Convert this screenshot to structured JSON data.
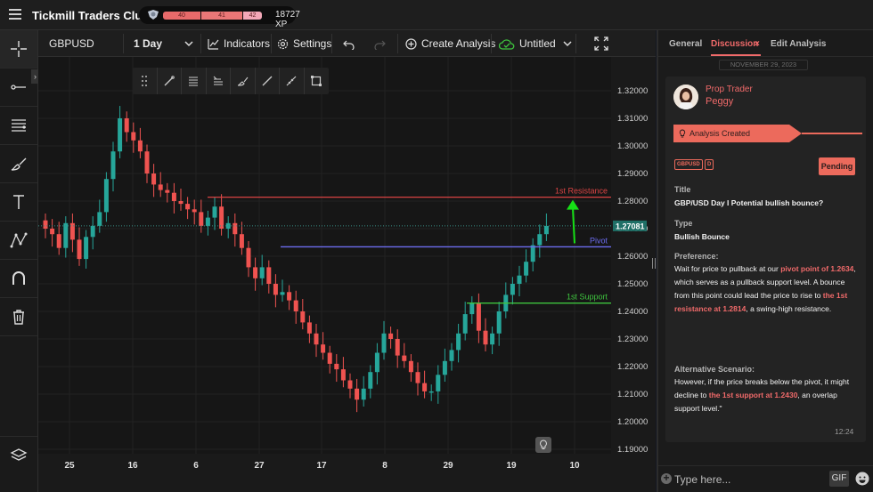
{
  "app": {
    "title": "Tickmill Traders Club"
  },
  "xp": {
    "level_1": "40",
    "level_2": "41",
    "level_3": "42",
    "total": "18727 XP"
  },
  "toolbar": {
    "symbol": "GBPUSD",
    "interval": "1 Day",
    "indicators_label": "Indicators",
    "settings_label": "Settings",
    "create_analysis_label": "Create Analysis",
    "layout_name": "Untitled"
  },
  "chart": {
    "last_price": "1.27081",
    "price_labels": [
      "1.32000",
      "1.31000",
      "1.30000",
      "1.29000",
      "1.28000",
      "1.27000",
      "1.26000",
      "1.25000",
      "1.24000",
      "1.23000",
      "1.22000",
      "1.21000",
      "1.20000",
      "1.19000"
    ],
    "date_labels": [
      "25",
      "16",
      "6",
      "27",
      "17",
      "8",
      "29",
      "19",
      "10"
    ],
    "resistance_label": "1st Resistance",
    "pivot_label": "Pivot",
    "support_label": "1st Support",
    "colors": {
      "up": "#26a69a",
      "down": "#ef5350",
      "resistance": "#d84343",
      "pivot": "#6c6cf0",
      "support": "#3ec43e",
      "arrow": "#16e016"
    }
  },
  "chart_data": {
    "type": "candlestick",
    "series": [
      {
        "name": "GBPUSD",
        "close": [
          1.27,
          1.268,
          1.263,
          1.272,
          1.266,
          1.259,
          1.267,
          1.271,
          1.276,
          1.288,
          1.298,
          1.31,
          1.305,
          1.302,
          1.298,
          1.29,
          1.286,
          1.284,
          1.283,
          1.28,
          1.279,
          1.277,
          1.276,
          1.271,
          1.274,
          1.278,
          1.27,
          1.272,
          1.268,
          1.263,
          1.256,
          1.252,
          1.256,
          1.25,
          1.246,
          1.247,
          1.244,
          1.24,
          1.236,
          1.232,
          1.228,
          1.225,
          1.221,
          1.219,
          1.215,
          1.212,
          1.208,
          1.212,
          1.218,
          1.225,
          1.232,
          1.23,
          1.224,
          1.222,
          1.218,
          1.214,
          1.211,
          1.211,
          1.217,
          1.222,
          1.226,
          1.232,
          1.239,
          1.243,
          1.233,
          1.228,
          1.232,
          1.24,
          1.246,
          1.25,
          1.253,
          1.258,
          1.264,
          1.268,
          1.271
        ]
      }
    ],
    "levels": {
      "resistance": 1.2814,
      "pivot": 1.2634,
      "support": 1.243
    },
    "ylim": [
      1.186,
      1.326
    ]
  },
  "right_panel": {
    "tabs": {
      "general": "General",
      "discussion": "Discussion",
      "edit": "Edit Analysis",
      "close": "×"
    },
    "date_separator": "NOVEMBER 29, 2023",
    "author_role": "Prop Trader",
    "author_name": "Peggy",
    "created_label": "Analysis Created",
    "tag_symbol": "GBPUSD",
    "tag_timeframe": "D",
    "status": "Pending",
    "title_label": "Title",
    "title_value": "GBP/USD Day I Potential bullish bounce?",
    "type_label": "Type",
    "type_value": "Bullish Bounce",
    "preference_label": "Preference:",
    "preference": {
      "p1": "Wait for price to pullback at our ",
      "h1": "pivot point of 1.2634",
      "p2": ", which serves as a pullback support level. A bounce from this point could lead the price to rise to ",
      "h2": "the 1st resistance at 1.2814",
      "p3": ", a swing-high resistance."
    },
    "alt_label": "Alternative Scenario:",
    "alternative": {
      "p1": "However, if the price breaks below the pivot, it might decline to ",
      "h1": "the 1st support at 1.2430",
      "p2": ", an overlap support level.\""
    },
    "time": "12:24",
    "input_placeholder": "Type here...",
    "gif_label": "GIF"
  }
}
